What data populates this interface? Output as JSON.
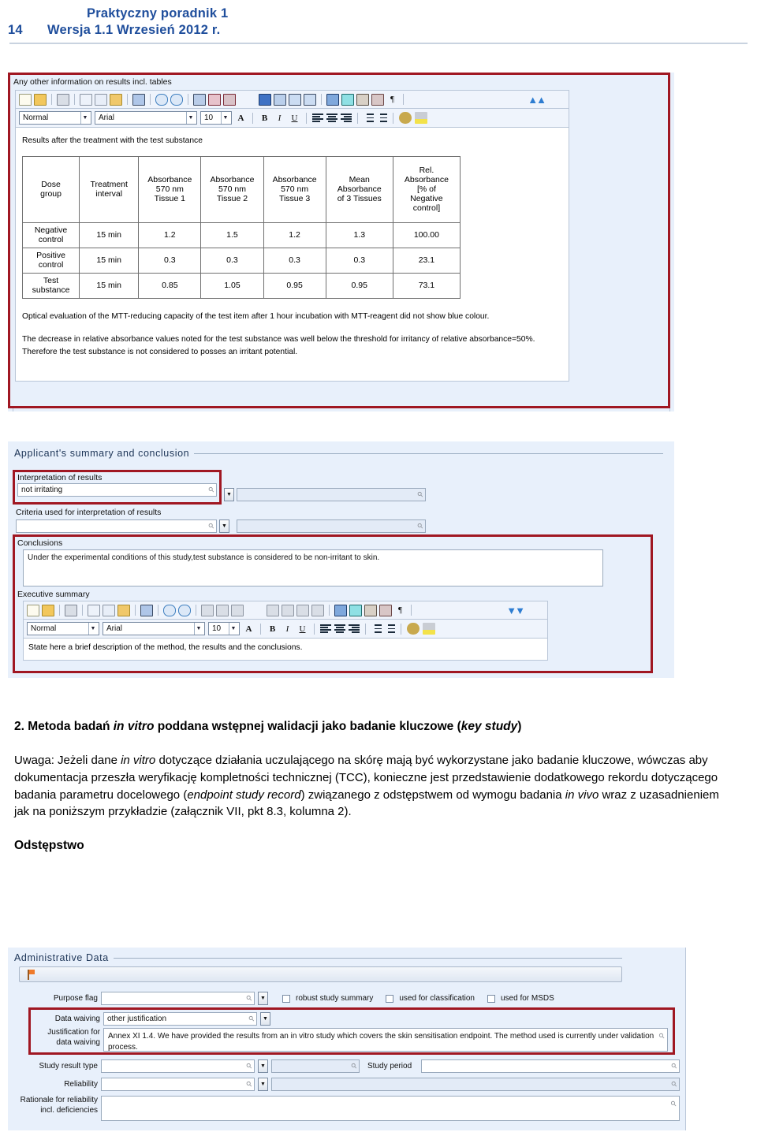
{
  "page_header": {
    "page_number": "14",
    "title_line1": "Praktyczny poradnik 1",
    "title_line2": "Wersja 1.1 Wrzesień 2012 r."
  },
  "screenshot_results": {
    "section_label": "Any other information on results incl. tables",
    "toolbar_primary": {
      "icons": [
        "new-document-icon",
        "open-folder-icon",
        "print-icon",
        "copy-icon",
        "cut-scissors-icon",
        "paste-icon",
        "insert-table-icon",
        "undo-icon",
        "redo-icon",
        "table-grid-icon",
        "table-header-row-icon",
        "table-header-column-icon",
        "indent-icon",
        "cell-fill-blue-icon",
        "cell-split-icon",
        "row-insert-icon",
        "column-insert-icon",
        "full-grid-icon",
        "cell-merge-icon",
        "image-insert-icon",
        "image-edit-icon",
        "pilcrow-icon"
      ],
      "collapse_label": "collapse-toolbar-icon"
    },
    "toolbar_format": {
      "style": "Normal",
      "font": "Arial",
      "size": "10",
      "buttons": [
        "font-color-icon",
        "bold-icon",
        "italic-icon",
        "underline-icon",
        "align-left-icon",
        "align-center-icon",
        "align-right-icon",
        "numbered-list-icon",
        "bullet-list-icon",
        "spellcheck-icon",
        "highlight-icon"
      ]
    },
    "content_heading": "Results after the treatment with the test substance",
    "table": {
      "headers": [
        "Dose\ngroup",
        "Treatment\ninterval",
        "Absorbance\n570 nm\nTissue 1",
        "Absorbance\n570 nm\nTissue 2",
        "Absorbance\n570 nm\nTissue 3",
        "Mean\nAbsorbance\nof 3 Tissues",
        "Rel.\nAbsorbance\n[% of\nNegative\ncontrol]"
      ],
      "rows": [
        [
          "Negative\ncontrol",
          "15 min",
          "1.2",
          "1.5",
          "1.2",
          "1.3",
          "100.00"
        ],
        [
          "Positive\ncontrol",
          "15 min",
          "0.3",
          "0.3",
          "0.3",
          "0.3",
          "23.1"
        ],
        [
          "Test\nsubstance",
          "15 min",
          "0.85",
          "1.05",
          "0.95",
          "0.95",
          "73.1"
        ]
      ]
    },
    "note_paragraph_1": "Optical evaluation of the MTT-reducing capacity of the test item after 1 hour incubation with MTT-reagent did not show blue colour.",
    "note_paragraph_2": "The decrease in relative absorbance values noted for the test substance was well below the threshold for irritancy of relative absorbance=50%.",
    "note_paragraph_3": "Therefore the test substance is not considered to posses an irritant potential."
  },
  "screenshot_summary": {
    "group_title": "Applicant's summary and conclusion",
    "interpretation_label": "Interpretation of results",
    "interpretation_value": "not irritating",
    "interpretation_secondary_value": "",
    "criteria_label": "Criteria used for interpretation of results",
    "criteria_value": "",
    "criteria_secondary_value": "",
    "conclusions_label": "Conclusions",
    "conclusions_value": "Under the experimental conditions of this study,test substance is considered to be non-irritant to skin.",
    "executive_summary_label": "Executive summary",
    "toolbar_format": {
      "style": "Normal",
      "font": "Arial",
      "size": "10"
    },
    "executive_summary_value": "State here a brief description of the method, the results and the conclusions."
  },
  "body_text": {
    "heading_prefix": "2. Metoda badań ",
    "heading_italic_1": "in vitro",
    "heading_mid": " poddana wstępnej walidacji jako badanie kluczowe (",
    "heading_italic_2": "key study",
    "heading_suffix": ")",
    "paragraph_part_1": "Uwaga: Jeżeli dane ",
    "paragraph_italic_1": "in vitro",
    "paragraph_part_2": " dotyczące działania uczulającego na skórę mają być wykorzystane jako badanie kluczowe, wówczas aby dokumentacja przeszła weryfikację kompletności technicznej (TCC), konieczne jest przedstawienie dodatkowego rekordu dotyczącego badania parametru docelowego (",
    "paragraph_italic_2": "endpoint study record",
    "paragraph_part_3": ") związanego z odstępstwem od wymogu badania ",
    "paragraph_italic_3": "in vivo",
    "paragraph_part_4": " wraz z uzasadnieniem jak na poniższym przykładzie (załącznik VII, pkt 8.3, kolumna 2).",
    "subheading": "Odstępstwo"
  },
  "screenshot_admin": {
    "group_title": "Administrative Data",
    "flag_icon": "orange-flag-icon",
    "purpose_flag_label": "Purpose flag",
    "purpose_flag_value": "",
    "checkboxes": [
      {
        "label": "robust study summary",
        "checked": false
      },
      {
        "label": "used for classification",
        "checked": false
      },
      {
        "label": "used for MSDS",
        "checked": false
      }
    ],
    "data_waiving_label": "Data waiving",
    "data_waiving_value": "other justification",
    "justification_label_line1": "Justification for",
    "justification_label_line2": "data waiving",
    "justification_value": "Annex XI 1.4. We have provided the results from an in vitro study which covers the skin sensitisation endpoint. The method used is currently under validation process.",
    "study_result_type_label": "Study result type",
    "study_result_type_value": "",
    "study_result_type_secondary": "",
    "study_period_label": "Study period",
    "study_period_value": "",
    "reliability_label": "Reliability",
    "reliability_value": "",
    "reliability_secondary": "",
    "rationale_label_line1": "Rationale for reliability",
    "rationale_label_line2": "incl. deficiencies",
    "rationale_value": ""
  },
  "colors": {
    "header_blue": "#1F4E9C",
    "highlight_red": "#A01722",
    "panel_blue": "#E8F0FB",
    "toolbar_blue": "#EFF4FC"
  }
}
